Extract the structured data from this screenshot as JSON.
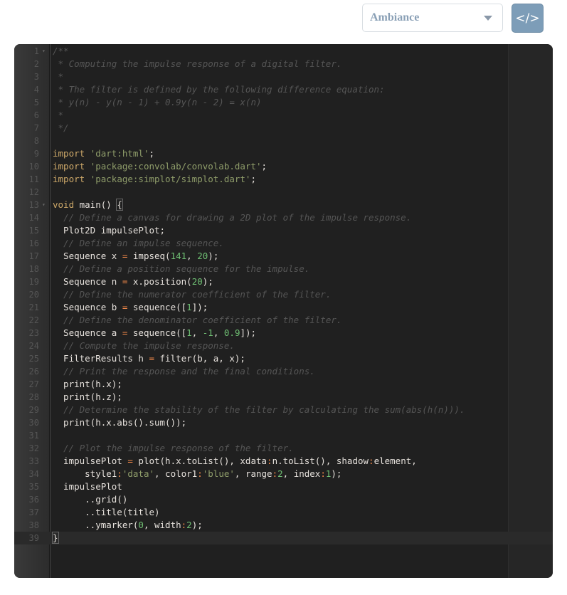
{
  "toolbar": {
    "theme_select": {
      "selected": "Ambiance"
    },
    "code_button": {
      "icon": "code-icon",
      "glyph": "</>"
    }
  },
  "editor": {
    "language": "dart",
    "active_line": 39,
    "lines": [
      [
        [
          "c",
          "/**"
        ]
      ],
      [
        [
          "c",
          " * Computing the impulse response of a digital filter."
        ]
      ],
      [
        [
          "c",
          " *"
        ]
      ],
      [
        [
          "c",
          " * The filter is defined by the following difference equation:"
        ]
      ],
      [
        [
          "c",
          " * y(n) - y(n - 1) + 0.9y(n - 2) = x(n)"
        ]
      ],
      [
        [
          "c",
          " *"
        ]
      ],
      [
        [
          "c",
          " */"
        ]
      ],
      [],
      [
        [
          "k",
          "import"
        ],
        [
          "t",
          " "
        ],
        [
          "s",
          "'dart:html'"
        ],
        [
          "t",
          ";"
        ]
      ],
      [
        [
          "k",
          "import"
        ],
        [
          "t",
          " "
        ],
        [
          "s",
          "'package:convolab/convolab.dart'"
        ],
        [
          "t",
          ";"
        ]
      ],
      [
        [
          "k",
          "import"
        ],
        [
          "t",
          " "
        ],
        [
          "s",
          "'package:simplot/simplot.dart'"
        ],
        [
          "t",
          ";"
        ]
      ],
      [],
      [
        [
          "k",
          "void"
        ],
        [
          "t",
          " main() "
        ],
        [
          "b",
          "{"
        ]
      ],
      [
        [
          "t",
          "  "
        ],
        [
          "c",
          "// Define a canvas for drawing a 2D plot of the impulse response."
        ]
      ],
      [
        [
          "t",
          "  Plot2D impulsePlot;"
        ]
      ],
      [
        [
          "t",
          "  "
        ],
        [
          "c",
          "// Define an impulse sequence."
        ]
      ],
      [
        [
          "t",
          "  Sequence x "
        ],
        [
          "o",
          "="
        ],
        [
          "t",
          " impseq("
        ],
        [
          "n",
          "141"
        ],
        [
          "t",
          ", "
        ],
        [
          "n",
          "20"
        ],
        [
          "t",
          ");"
        ]
      ],
      [
        [
          "t",
          "  "
        ],
        [
          "c",
          "// Define a position sequence for the impulse."
        ]
      ],
      [
        [
          "t",
          "  Sequence n "
        ],
        [
          "o",
          "="
        ],
        [
          "t",
          " x.position("
        ],
        [
          "n",
          "20"
        ],
        [
          "t",
          ");"
        ]
      ],
      [
        [
          "t",
          "  "
        ],
        [
          "c",
          "// Define the numerator coefficient of the filter."
        ]
      ],
      [
        [
          "t",
          "  Sequence b "
        ],
        [
          "o",
          "="
        ],
        [
          "t",
          " sequence(["
        ],
        [
          "n",
          "1"
        ],
        [
          "t",
          "]);"
        ]
      ],
      [
        [
          "t",
          "  "
        ],
        [
          "c",
          "// Define the denominator coefficient of the filter."
        ]
      ],
      [
        [
          "t",
          "  Sequence a "
        ],
        [
          "o",
          "="
        ],
        [
          "t",
          " sequence(["
        ],
        [
          "n",
          "1"
        ],
        [
          "t",
          ", "
        ],
        [
          "n",
          "-1"
        ],
        [
          "t",
          ", "
        ],
        [
          "n",
          "0.9"
        ],
        [
          "t",
          "]);"
        ]
      ],
      [
        [
          "t",
          "  "
        ],
        [
          "c",
          "// Compute the impulse response."
        ]
      ],
      [
        [
          "t",
          "  FilterResults h "
        ],
        [
          "o",
          "="
        ],
        [
          "t",
          " filter(b, a, x);"
        ]
      ],
      [
        [
          "t",
          "  "
        ],
        [
          "c",
          "// Print the response and the final conditions."
        ]
      ],
      [
        [
          "t",
          "  print(h.x);"
        ]
      ],
      [
        [
          "t",
          "  print(h.z);"
        ]
      ],
      [
        [
          "t",
          "  "
        ],
        [
          "c",
          "// Determine the stability of the filter by calculating the sum(abs(h(n)))."
        ]
      ],
      [
        [
          "t",
          "  print(h.x.abs().sum());"
        ]
      ],
      [],
      [
        [
          "t",
          "  "
        ],
        [
          "c",
          "// Plot the impulse response of the filter."
        ]
      ],
      [
        [
          "t",
          "  impulsePlot "
        ],
        [
          "o",
          "="
        ],
        [
          "t",
          " plot(h.x.toList(), xdata"
        ],
        [
          "o",
          ":"
        ],
        [
          "t",
          "n.toList(), shadow"
        ],
        [
          "o",
          ":"
        ],
        [
          "t",
          "element,"
        ]
      ],
      [
        [
          "t",
          "      style1"
        ],
        [
          "o",
          ":"
        ],
        [
          "s",
          "'data'"
        ],
        [
          "t",
          ", color1"
        ],
        [
          "o",
          ":"
        ],
        [
          "s",
          "'blue'"
        ],
        [
          "t",
          ", range"
        ],
        [
          "o",
          ":"
        ],
        [
          "n",
          "2"
        ],
        [
          "t",
          ", index"
        ],
        [
          "o",
          ":"
        ],
        [
          "n",
          "1"
        ],
        [
          "t",
          ");"
        ]
      ],
      [
        [
          "t",
          "  impulsePlot"
        ]
      ],
      [
        [
          "t",
          "      ..grid()"
        ]
      ],
      [
        [
          "t",
          "      ..title(title)"
        ]
      ],
      [
        [
          "t",
          "      ..ymarker("
        ],
        [
          "n",
          "0"
        ],
        [
          "t",
          ", width"
        ],
        [
          "o",
          ":"
        ],
        [
          "n",
          "2"
        ],
        [
          "t",
          ");"
        ]
      ],
      [
        [
          "b",
          "}"
        ]
      ]
    ],
    "foldable_lines": [
      1,
      13
    ]
  }
}
